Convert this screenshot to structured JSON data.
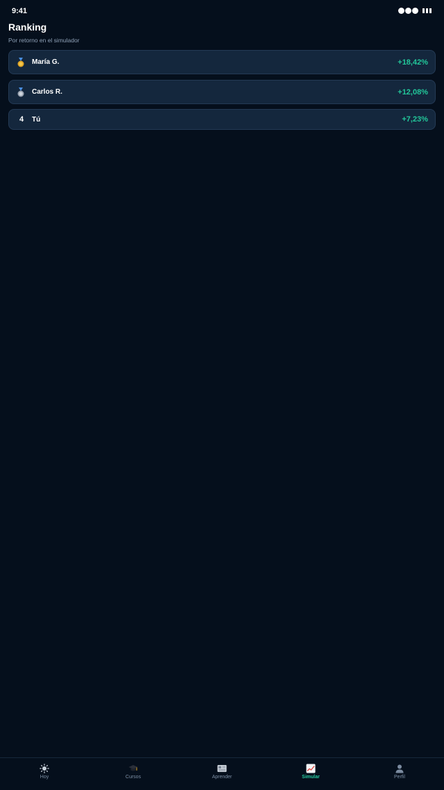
{
  "status_bar": {
    "time": "9:41"
  },
  "header": {
    "title": "Ranking",
    "subtitle": "Por retorno en el simulador"
  },
  "ranking": [
    {
      "badge_icon": "gold-medal-icon",
      "name": "María G.",
      "return": "+18,42%"
    },
    {
      "badge_icon": "silver-medal-icon",
      "name": "Carlos R.",
      "return": "+12,08%"
    },
    {
      "position": "4",
      "name": "Tú",
      "return": "+7,23%"
    }
  ],
  "tab_bar": {
    "active": "Simular",
    "items": [
      {
        "label": "Hoy",
        "icon": "sun-icon"
      },
      {
        "label": "Cursos",
        "icon": "graduation-cap-icon"
      },
      {
        "label": "Aprender",
        "icon": "newspaper-icon"
      },
      {
        "label": "Simular",
        "icon": "chart-icon"
      },
      {
        "label": "Perfil",
        "icon": "user-icon"
      }
    ]
  },
  "colors": {
    "background": "#050f1c",
    "card": "#14273d",
    "accent_green": "#22c79a",
    "gold": "#e0a526",
    "silver": "#b8c0cc"
  }
}
